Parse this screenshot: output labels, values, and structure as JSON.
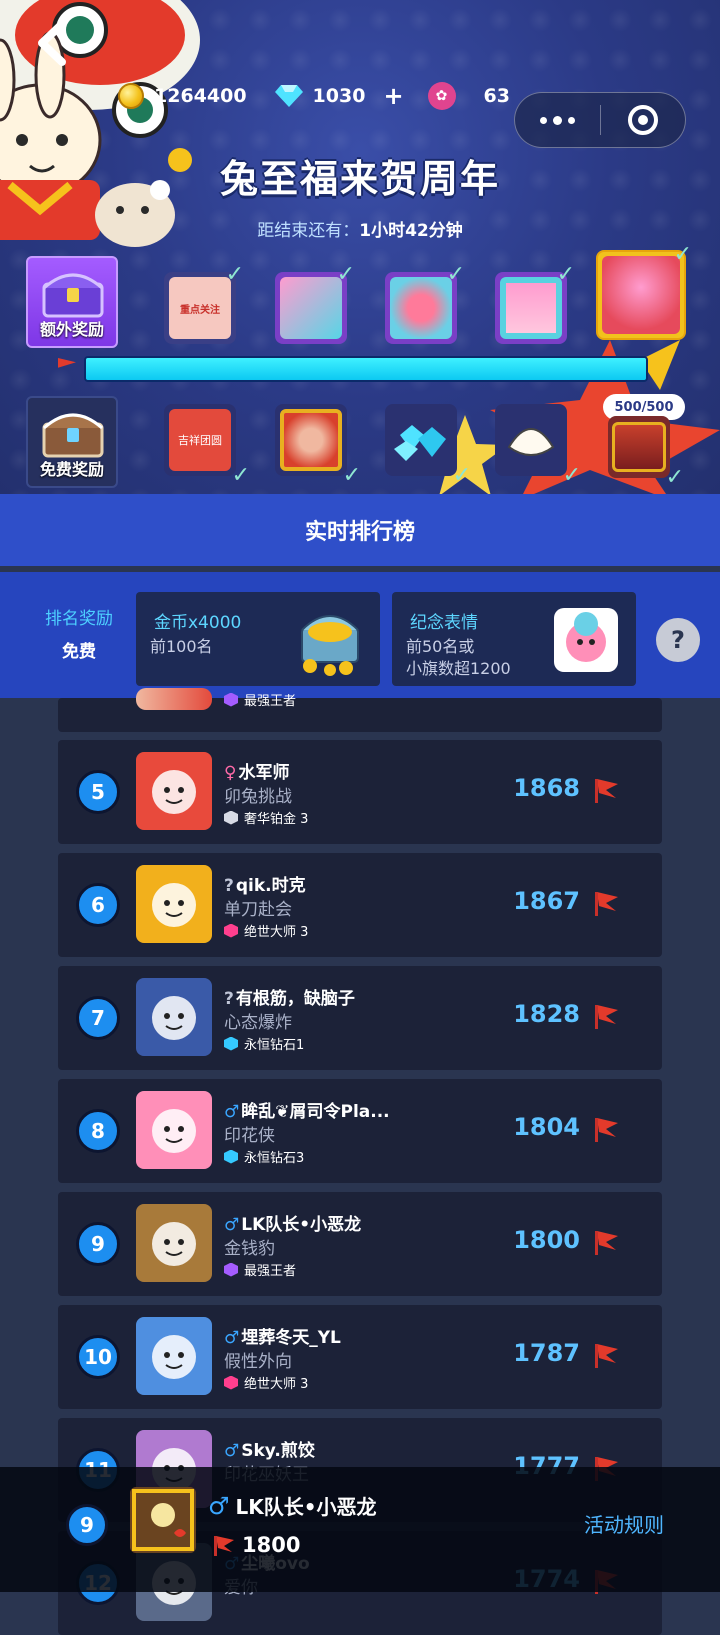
{
  "currency": {
    "coins": "1264400",
    "diamonds": "1030",
    "plus": "+",
    "tulips": "63"
  },
  "event": {
    "title": "兔至福来贺周年",
    "countdown_label": "距结束还有：",
    "countdown_value": "1小时42分钟"
  },
  "rewards": {
    "extra_label": "额外奖励",
    "free_label": "免费奖励",
    "progress_text": "500/500",
    "progress_fraction": 1.0,
    "check_mark": "✓",
    "extra_item_texts": [
      "重点关注"
    ],
    "free_item_texts": [
      "吉祥团圆"
    ]
  },
  "ranking": {
    "title": "实时排行榜",
    "prize_label_1": "排名奖励",
    "prize_label_2": "免费",
    "prizes": [
      {
        "name": "金币x4000",
        "desc_line1": "前100名",
        "desc_line2": ""
      },
      {
        "name": "纪念表情",
        "desc_line1": "前50名或",
        "desc_line2": "小旗数超1200"
      }
    ],
    "help": "?"
  },
  "partial_row": {
    "tier": "最强王者"
  },
  "rows": [
    {
      "rank": "5",
      "gender": "♀",
      "name": "水军师",
      "title": "卯兔挑战",
      "tier": "奢华铂金 3",
      "score": "1868",
      "tier_color": "#d8dbe6"
    },
    {
      "rank": "6",
      "gender": "?",
      "name": "qik.时克",
      "title": "单刀赴会",
      "tier": "绝世大师 3",
      "score": "1867",
      "tier_color": "#ff3f8e"
    },
    {
      "rank": "7",
      "gender": "?",
      "name": "有根筋，缺脑子",
      "title": "心态爆炸",
      "tier": "永恒钻石1",
      "score": "1828",
      "tier_color": "#35c9ff"
    },
    {
      "rank": "8",
      "gender": "♂",
      "name": "眸乱❦屑司令Pla...",
      "title": "印花侠",
      "tier": "永恒钻石3",
      "score": "1804",
      "tier_color": "#35c9ff"
    },
    {
      "rank": "9",
      "gender": "♂",
      "name": "LK队长•小恶龙",
      "title": "金钱豹",
      "tier": "最强王者",
      "score": "1800",
      "tier_color": "#a45cff"
    },
    {
      "rank": "10",
      "gender": "♂",
      "name": "埋葬冬天_YL",
      "title": "假性外向",
      "tier": "绝世大师 3",
      "score": "1787",
      "tier_color": "#ff3f8e"
    },
    {
      "rank": "11",
      "gender": "♂",
      "name": "Sky.煎饺",
      "title": "印花巫妖王",
      "tier": "",
      "score": "1777",
      "tier_color": "#a45cff"
    },
    {
      "rank": "12",
      "gender": "♂",
      "name": "尘曦ovo",
      "title": "爱你",
      "tier": "",
      "score": "1774",
      "tier_color": "#a45cff"
    }
  ],
  "self": {
    "rank": "9",
    "gender": "♂",
    "name": "LK队长•小恶龙",
    "score": "1800",
    "rules_label": "活动规则"
  },
  "colors": {
    "accent_blue": "#2f4fc9",
    "score_blue": "#5ec2ff",
    "rank_circle": "#1d8ef0"
  }
}
